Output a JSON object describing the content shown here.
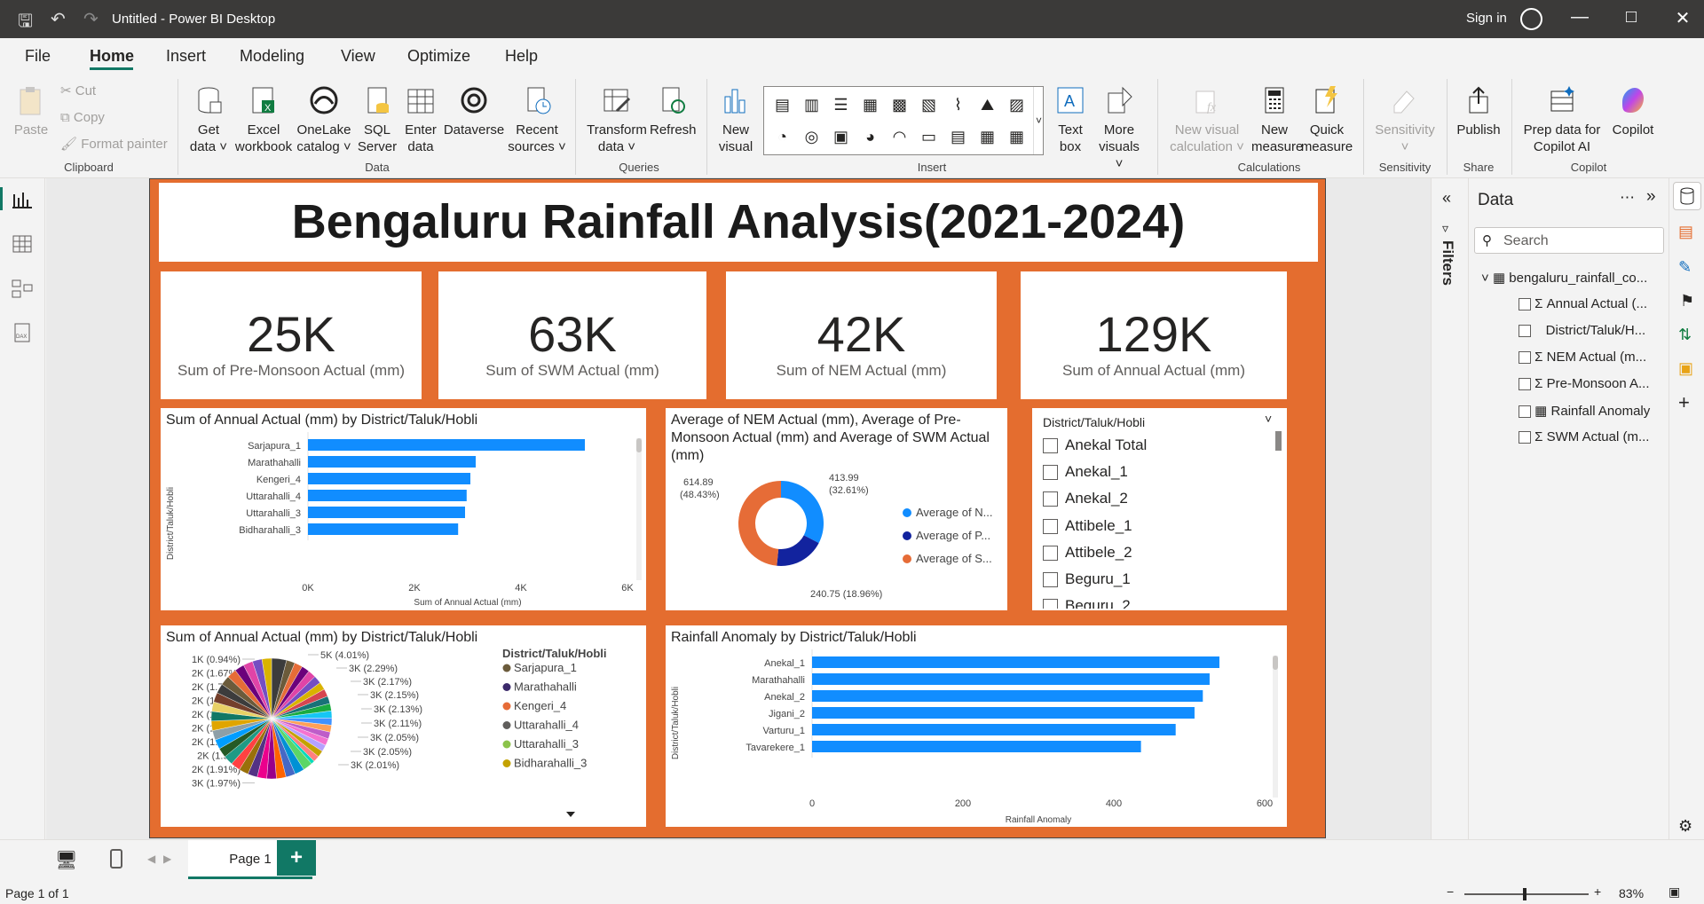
{
  "app": {
    "title": "Untitled - Power BI Desktop",
    "sign_in": "Sign in"
  },
  "menu": [
    "File",
    "Home",
    "Insert",
    "Modeling",
    "View",
    "Optimize",
    "Help"
  ],
  "ribbon": {
    "clipboard": {
      "paste": "Paste",
      "cut": "Cut",
      "copy": "Copy",
      "format_painter": "Format painter",
      "group": "Clipboard"
    },
    "data": {
      "get_data": "Get data",
      "excel": "Excel workbook",
      "onelake": "OneLake catalog",
      "sql": "SQL Server",
      "enter": "Enter data",
      "dataverse": "Dataverse",
      "recent": "Recent sources",
      "group": "Data"
    },
    "queries": {
      "transform": "Transform data",
      "refresh": "Refresh",
      "group": "Queries"
    },
    "insert": {
      "new_visual": "New visual",
      "text_box": "Text box",
      "more_visuals": "More visuals",
      "group": "Insert"
    },
    "calculations": {
      "new_visual_calc": "New visual calculation",
      "new_measure": "New measure",
      "quick_measure": "Quick measure",
      "group": "Calculations"
    },
    "sensitivity": {
      "label": "Sensitivity",
      "group": "Sensitivity"
    },
    "share": {
      "publish": "Publish",
      "group": "Share"
    },
    "copilot": {
      "prep": "Prep data for Copilot AI",
      "copilot": "Copilot",
      "group": "Copilot"
    }
  },
  "report": {
    "title": "Bengaluru Rainfall Analysis(2021-2024)",
    "kpis": [
      {
        "value": "25K",
        "label": "Sum of Pre-Monsoon Actual (mm)"
      },
      {
        "value": "63K",
        "label": "Sum of SWM Actual (mm)"
      },
      {
        "value": "42K",
        "label": "Sum of NEM Actual (mm)"
      },
      {
        "value": "129K",
        "label": "Sum of Annual Actual (mm)"
      }
    ],
    "bar1": {
      "title": "Sum of Annual Actual (mm) by District/Taluk/Hobli",
      "ylabel": "District/Taluk/Hobli",
      "xlabel": "Sum of Annual Actual (mm)",
      "ticks": [
        "0K",
        "2K",
        "4K",
        "6K"
      ]
    },
    "donut": {
      "title": "Average of NEM Actual (mm), Average of Pre-Monsoon Actual (mm) and Average of SWM Actual (mm)",
      "labels": {
        "a": "413.99",
        "a_pct": "(32.61%)",
        "b": "240.75 (18.96%)",
        "c": "614.89",
        "c_pct": "(48.43%)"
      },
      "legend": [
        "Average of N...",
        "Average of P...",
        "Average of S..."
      ]
    },
    "slicer": {
      "title": "District/Taluk/Hobli",
      "items": [
        "Anekal Total",
        "Anekal_1",
        "Anekal_2",
        "Attibele_1",
        "Attibele_2",
        "Beguru_1",
        "Beguru_2"
      ]
    },
    "pie": {
      "title": "Sum of Annual Actual (mm) by District/Taluk/Hobli",
      "legend_title": "District/Taluk/Hobli",
      "legend": [
        "Sarjapura_1",
        "Marathahalli",
        "Kengeri_4",
        "Uttarahalli_4",
        "Uttarahalli_3",
        "Bidharahalli_3"
      ],
      "left_labels": [
        "1K (0.94%)",
        "2K (1.67%)",
        "2K (1.73%)",
        "2K (1.79%)",
        "2K (1.84%)",
        "2K (1.86%)",
        "2K (1.88%)",
        "2K (1.9%)",
        "2K (1.91%)",
        "3K (1.97%)"
      ],
      "right_labels": [
        "5K (4.01%)",
        "3K (2.29%)",
        "3K (2.17%)",
        "3K (2.15%)",
        "3K (2.13%)",
        "3K (2.11%)",
        "3K (2.05%)",
        "3K (2.05%)",
        "3K (2.01%)"
      ]
    },
    "bar2": {
      "title": "Rainfall Anomaly by District/Taluk/Hobli",
      "ylabel": "District/Taluk/Hobli",
      "xlabel": "Rainfall Anomaly",
      "ticks": [
        "0",
        "200",
        "400",
        "600"
      ]
    }
  },
  "chart_data": [
    {
      "type": "bar",
      "orientation": "horizontal",
      "title": "Sum of Annual Actual (mm) by District/Taluk/Hobli",
      "categories": [
        "Sarjapura_1",
        "Marathahalli",
        "Kengeri_4",
        "Uttarahalli_4",
        "Uttarahalli_3",
        "Bidharahalli_3"
      ],
      "values": [
        5200,
        3150,
        3050,
        2980,
        2950,
        2820
      ],
      "xlim": [
        0,
        6000
      ],
      "color": "#118dff"
    },
    {
      "type": "pie",
      "donut": true,
      "values": [
        413.99,
        240.75,
        614.89
      ],
      "labels": [
        "Average of N...",
        "Average of P...",
        "Average of S..."
      ],
      "colors": [
        "#118dff",
        "#12239e",
        "#e66c37"
      ]
    },
    {
      "type": "bar",
      "orientation": "horizontal",
      "title": "Rainfall Anomaly by District/Taluk/Hobli",
      "categories": [
        "Anekal_1",
        "Marathahalli",
        "Anekal_2",
        "Jigani_2",
        "Varturu_1",
        "Tavarekere_1"
      ],
      "values": [
        540,
        527,
        518,
        507,
        482,
        436
      ],
      "xlim": [
        0,
        600
      ],
      "color": "#118dff"
    }
  ],
  "datapane": {
    "title": "Data",
    "search": "Search",
    "table": "bengaluru_rainfall_co...",
    "fields": [
      "Annual Actual (...",
      "District/Taluk/H...",
      "NEM Actual (m...",
      "Pre-Monsoon A...",
      "Rainfall Anomaly",
      "SWM Actual (m..."
    ]
  },
  "filters": "Filters",
  "page": {
    "tab": "Page 1",
    "status": "Page 1 of 1",
    "zoom": "83%"
  }
}
